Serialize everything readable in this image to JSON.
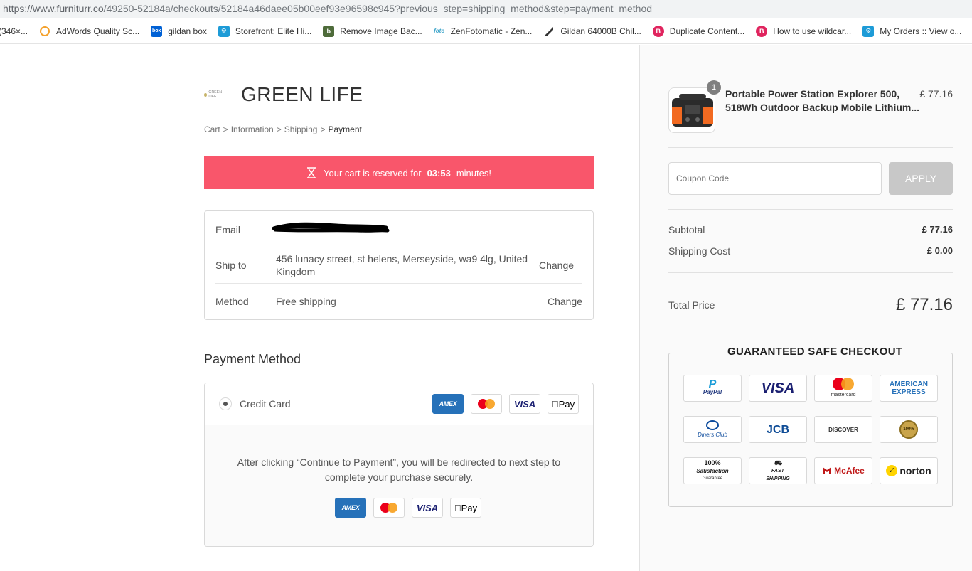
{
  "browser": {
    "url_host": "https://www.furniturr.co",
    "url_path": "/49250-52184a/checkouts/52184a46daee05b00eef93e96598c945?previous_step=shipping_method&step=payment_method",
    "bookmarks": [
      {
        "label": "(346×...",
        "icon": "page-icon",
        "color": "#5f6368"
      },
      {
        "label": "AdWords Quality Sc...",
        "icon": "adwords-icon",
        "color": "#f4a12c"
      },
      {
        "label": "gildan box",
        "icon": "box-icon",
        "color": "#0061d5"
      },
      {
        "label": "Storefront: Elite Hi...",
        "icon": "gear-icon",
        "color": "#1d9bd7"
      },
      {
        "label": "Remove Image Bac...",
        "icon": "b-icon",
        "color": "#4e6b3a"
      },
      {
        "label": "ZenFotomatic - Zen...",
        "icon": "foto-icon",
        "color": "#3aa3c9"
      },
      {
        "label": "Gildan 64000B Chil...",
        "icon": "pen-icon",
        "color": "#333333"
      },
      {
        "label": "Duplicate Content...",
        "icon": "b-circle-icon",
        "color": "#e0245e"
      },
      {
        "label": "How to use wildcar...",
        "icon": "b-circle-icon",
        "color": "#e0245e"
      },
      {
        "label": "My Orders :: View o...",
        "icon": "gear-icon",
        "color": "#1d9bd7"
      },
      {
        "label": "",
        "icon": "gear-icon",
        "color": "#1d9bd7"
      }
    ]
  },
  "shop": {
    "logo_text": "GREEN LIFE",
    "name": "GREEN LIFE"
  },
  "breadcrumb": {
    "items": [
      "Cart",
      "Information",
      "Shipping"
    ],
    "current": "Payment",
    "separator": ">"
  },
  "timer": {
    "prefix": "Your cart is reserved for",
    "time": "03:53",
    "suffix": "minutes!",
    "bg_color": "#f9566b"
  },
  "review": {
    "email_label": "Email",
    "email_value": "",
    "ship_label": "Ship to",
    "ship_value": "456 lunacy street, st helens, Merseyside, wa9 4lg, United Kingdom",
    "method_label": "Method",
    "method_value": "Free shipping",
    "change_label": "Change"
  },
  "payment": {
    "title": "Payment Method",
    "option_label": "Credit Card",
    "note": "After clicking “Continue to Payment”, you will be redirected to next step to complete your purchase securely.",
    "cards": {
      "amex": "AMEX",
      "visa": "VISA",
      "apple": "Pay"
    }
  },
  "summary": {
    "product": {
      "name": "Portable Power Station Explorer 500, 518Wh Outdoor Backup Mobile Lithium...",
      "price": "£ 77.16",
      "quantity": "1"
    },
    "coupon_placeholder": "Coupon Code",
    "apply_label": "APPLY",
    "subtotal_label": "Subtotal",
    "subtotal_value": "£ 77.16",
    "shipping_label": "Shipping Cost",
    "shipping_value": "£ 0.00",
    "total_label": "Total Price",
    "total_value": "£ 77.16"
  },
  "guarantee": {
    "title": "GUARANTEED SAFE CHECKOUT",
    "badges": {
      "paypal": "PayPal",
      "visa": "VISA",
      "mastercard": "mastercard",
      "amex_line1": "AMERICAN",
      "amex_line2": "EXPRESS",
      "diners": "Diners Club",
      "jcb": "JCB",
      "discover": "DISCOVER",
      "seal": "100%",
      "satisfaction_line1": "100%",
      "satisfaction_line2": "Satisfaction",
      "satisfaction_line3": "Guarantee",
      "fast_line1": "FAST",
      "fast_line2": "SHIPPING",
      "mcafee": "McAfee",
      "norton": "norton"
    }
  }
}
